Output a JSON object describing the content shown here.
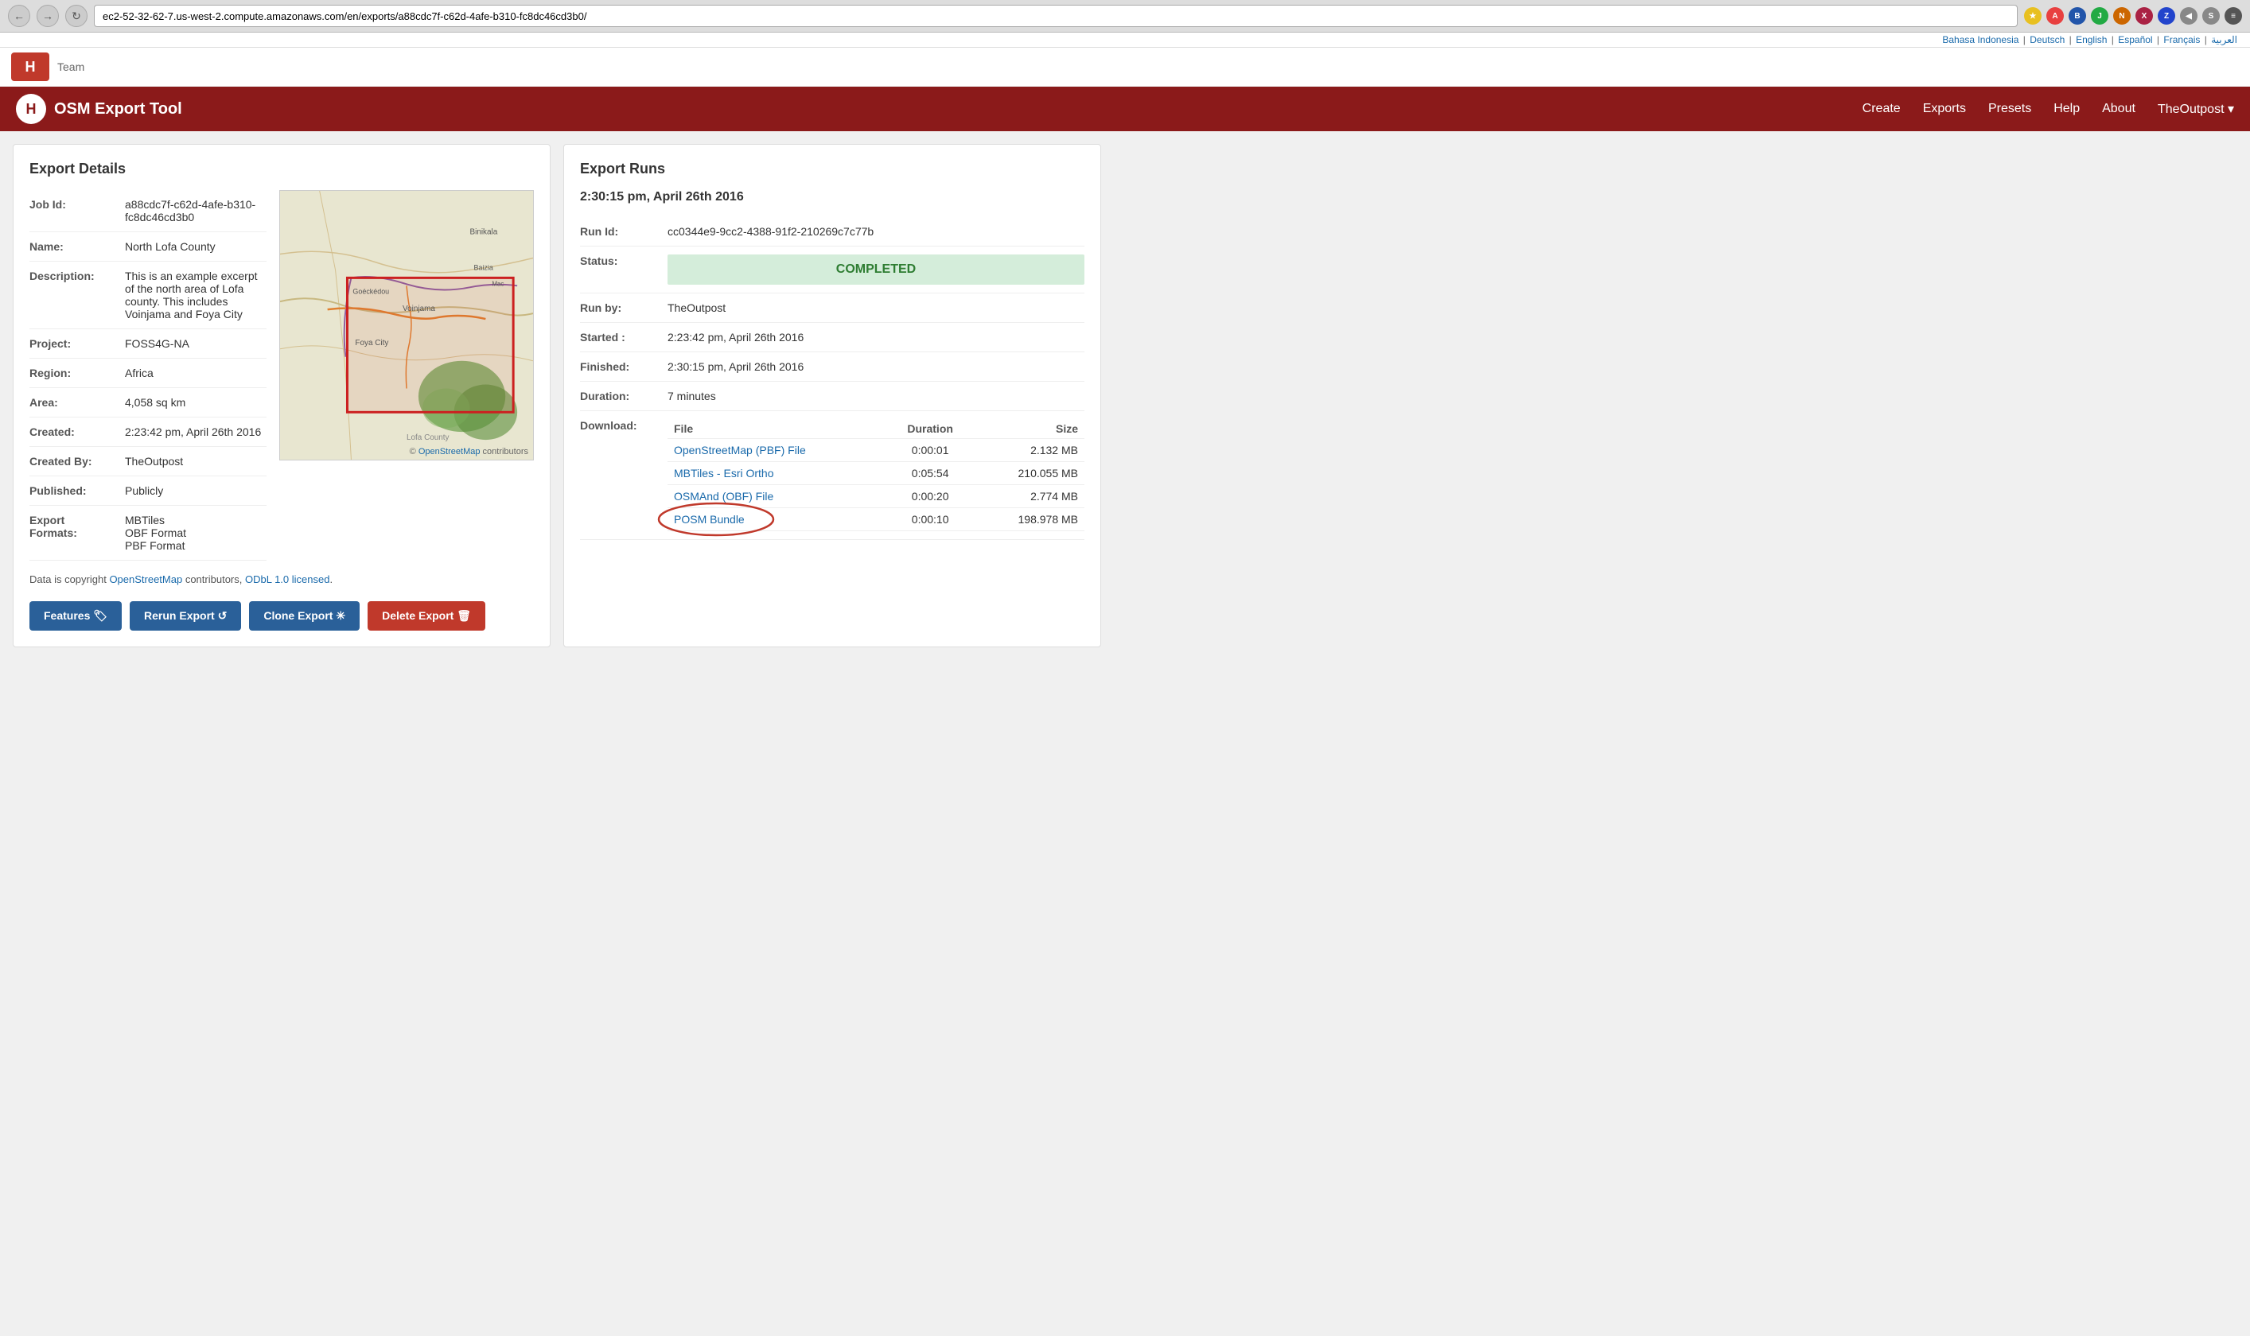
{
  "browser": {
    "url": "ec2-52-32-62-7.us-west-2.compute.amazonaws.com/en/exports/a88cdc7f-c62d-4afe-b310-fc8dc46cd3b0/"
  },
  "lang_bar": {
    "links": [
      "Bahasa Indonesia",
      "Deutsch",
      "English",
      "Español",
      "Français",
      "العربية"
    ]
  },
  "nav": {
    "title": "OSM Export Tool",
    "links": [
      "Create",
      "Exports",
      "Presets",
      "Help",
      "About",
      "TheOutpost ▾"
    ]
  },
  "export_details": {
    "section_title": "Export Details",
    "fields": [
      {
        "label": "Job Id:",
        "value": "a88cdc7f-c62d-4afe-b310-\nfc8dc46cd3b0"
      },
      {
        "label": "Name:",
        "value": "North Lofa County"
      },
      {
        "label": "Description:",
        "value": "This is an example excerpt of the north area of Lofa county. This includes Voinjama and Foya City"
      },
      {
        "label": "Project:",
        "value": "FOSS4G-NA"
      },
      {
        "label": "Region:",
        "value": "Africa"
      },
      {
        "label": "Area:",
        "value": "4,058 sq km"
      },
      {
        "label": "Created:",
        "value": "2:23:42 pm, April 26th 2016"
      },
      {
        "label": "Created By:",
        "value": "TheOutpost"
      },
      {
        "label": "Published:",
        "value": "Publicly"
      },
      {
        "label": "Export Formats:",
        "value": "MBTiles\nOBF Format\nPBF Format"
      }
    ],
    "copyright": "Data is copyright ",
    "copyright_link1": "OpenStreetMap",
    "copyright_mid": " contributors, ",
    "copyright_link2": "ODbL 1.0 licensed",
    "copyright_end": ".",
    "map_credit_prefix": "© ",
    "map_credit_link": "OpenStreetMap",
    "map_credit_suffix": " contributors"
  },
  "buttons": [
    {
      "label": "Features 🏷",
      "type": "blue",
      "name": "features-button"
    },
    {
      "label": "Rerun Export ↺",
      "type": "blue",
      "name": "rerun-export-button"
    },
    {
      "label": "Clone Export ✳",
      "type": "blue",
      "name": "clone-export-button"
    },
    {
      "label": "Delete Export 🗑",
      "type": "red",
      "name": "delete-export-button"
    }
  ],
  "export_runs": {
    "section_title": "Export Runs",
    "run_date": "2:30:15 pm, April 26th 2016",
    "fields": [
      {
        "label": "Run Id:",
        "value": "cc0344e9-9cc2-4388-91f2-210269c7c77b"
      },
      {
        "label": "Status:",
        "value": "COMPLETED",
        "type": "status"
      },
      {
        "label": "Run by:",
        "value": "TheOutpost"
      },
      {
        "label": "Started :",
        "value": "2:23:42 pm, April 26th 2016"
      },
      {
        "label": "Finished:",
        "value": "2:30:15 pm, April 26th 2016"
      },
      {
        "label": "Duration:",
        "value": "7 minutes"
      },
      {
        "label": "Download:",
        "type": "download"
      }
    ],
    "download_headers": [
      "File",
      "Duration",
      "Size"
    ],
    "download_rows": [
      {
        "file": "OpenStreetMap (PBF) File",
        "duration": "0:00:01",
        "size": "2.132 MB",
        "highlight": false
      },
      {
        "file": "MBTiles - Esri Ortho",
        "duration": "0:05:54",
        "size": "210.055 MB",
        "highlight": false
      },
      {
        "file": "OSMAnd (OBF) File",
        "duration": "0:00:20",
        "size": "2.774 MB",
        "highlight": false
      },
      {
        "file": "POSM Bundle",
        "duration": "0:00:10",
        "size": "198.978 MB",
        "highlight": true
      }
    ]
  }
}
